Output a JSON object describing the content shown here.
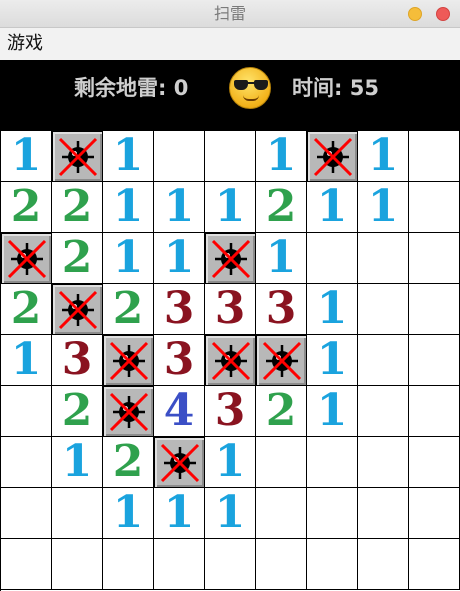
{
  "window": {
    "title": "扫雷"
  },
  "menu": {
    "game_label": "游戏"
  },
  "status": {
    "mines_remaining_label": "剩余地雷: 0",
    "time_label": "时间: 55"
  },
  "icons": {
    "face": "sunglasses-smiley-icon",
    "mine": "flagged-mine-icon"
  },
  "colors": {
    "n1": "#1aa3de",
    "n2": "#2fa14d",
    "n3": "#8a1320",
    "n4": "#3b4fc6",
    "mine_x": "#ff0000"
  },
  "board": {
    "rows": 9,
    "cols": 9,
    "cells": [
      [
        "1",
        "M",
        "1",
        "",
        "",
        "1",
        "M",
        "1",
        ""
      ],
      [
        "2",
        "2",
        "1",
        "1",
        "1",
        "2",
        "1",
        "1",
        ""
      ],
      [
        "M",
        "2",
        "1",
        "1",
        "M",
        "1",
        "",
        "",
        ""
      ],
      [
        "2",
        "M",
        "2",
        "3",
        "3",
        "3",
        "1",
        "",
        ""
      ],
      [
        "1",
        "3",
        "M",
        "3",
        "M",
        "M",
        "1",
        "",
        ""
      ],
      [
        "",
        "2",
        "M",
        "4",
        "3",
        "2",
        "1",
        "",
        ""
      ],
      [
        "",
        "1",
        "2",
        "M",
        "1",
        "",
        "",
        "",
        ""
      ],
      [
        "",
        "",
        "1",
        "1",
        "1",
        "",
        "",
        "",
        ""
      ],
      [
        "",
        "",
        "",
        "",
        "",
        "",
        "",
        "",
        ""
      ]
    ]
  }
}
